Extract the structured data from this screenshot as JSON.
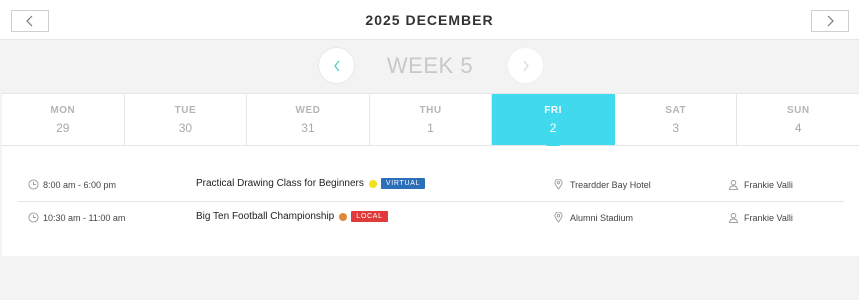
{
  "header": {
    "month_title": "2025 DECEMBER",
    "prev_icon": "chevron-left-icon",
    "next_icon": "chevron-right-icon"
  },
  "week": {
    "label": "WEEK 5",
    "prev_icon": "chevron-left-icon",
    "next_icon": "chevron-right-icon"
  },
  "days": [
    {
      "name": "MON",
      "num": "29",
      "active": false
    },
    {
      "name": "TUE",
      "num": "30",
      "active": false
    },
    {
      "name": "WED",
      "num": "31",
      "active": false
    },
    {
      "name": "THU",
      "num": "1",
      "active": false
    },
    {
      "name": "FRI",
      "num": "2",
      "active": true
    },
    {
      "name": "SAT",
      "num": "3",
      "active": false
    },
    {
      "name": "SUN",
      "num": "4",
      "active": false
    }
  ],
  "events": [
    {
      "time": "8:00 am - 6:00 pm",
      "title": "Practical Drawing Class for Beginners",
      "dot_color": "#f2e21a",
      "badge": "VIRTUAL",
      "badge_color": "#2a6fb8",
      "venue": "Treardder Bay Hotel",
      "organizer": "Frankie Valli"
    },
    {
      "time": "10:30 am - 11:00 am",
      "title": "Big Ten Football Championship",
      "dot_color": "#e0883a",
      "badge": "LOCAL",
      "badge_color": "#e03a3a",
      "venue": "Alumni Stadium",
      "organizer": "Frankie Valli"
    }
  ],
  "colors": {
    "accent": "#40d9ee",
    "arrow_active": "#5fcfc3",
    "arrow_disabled": "#d6d6d6"
  }
}
